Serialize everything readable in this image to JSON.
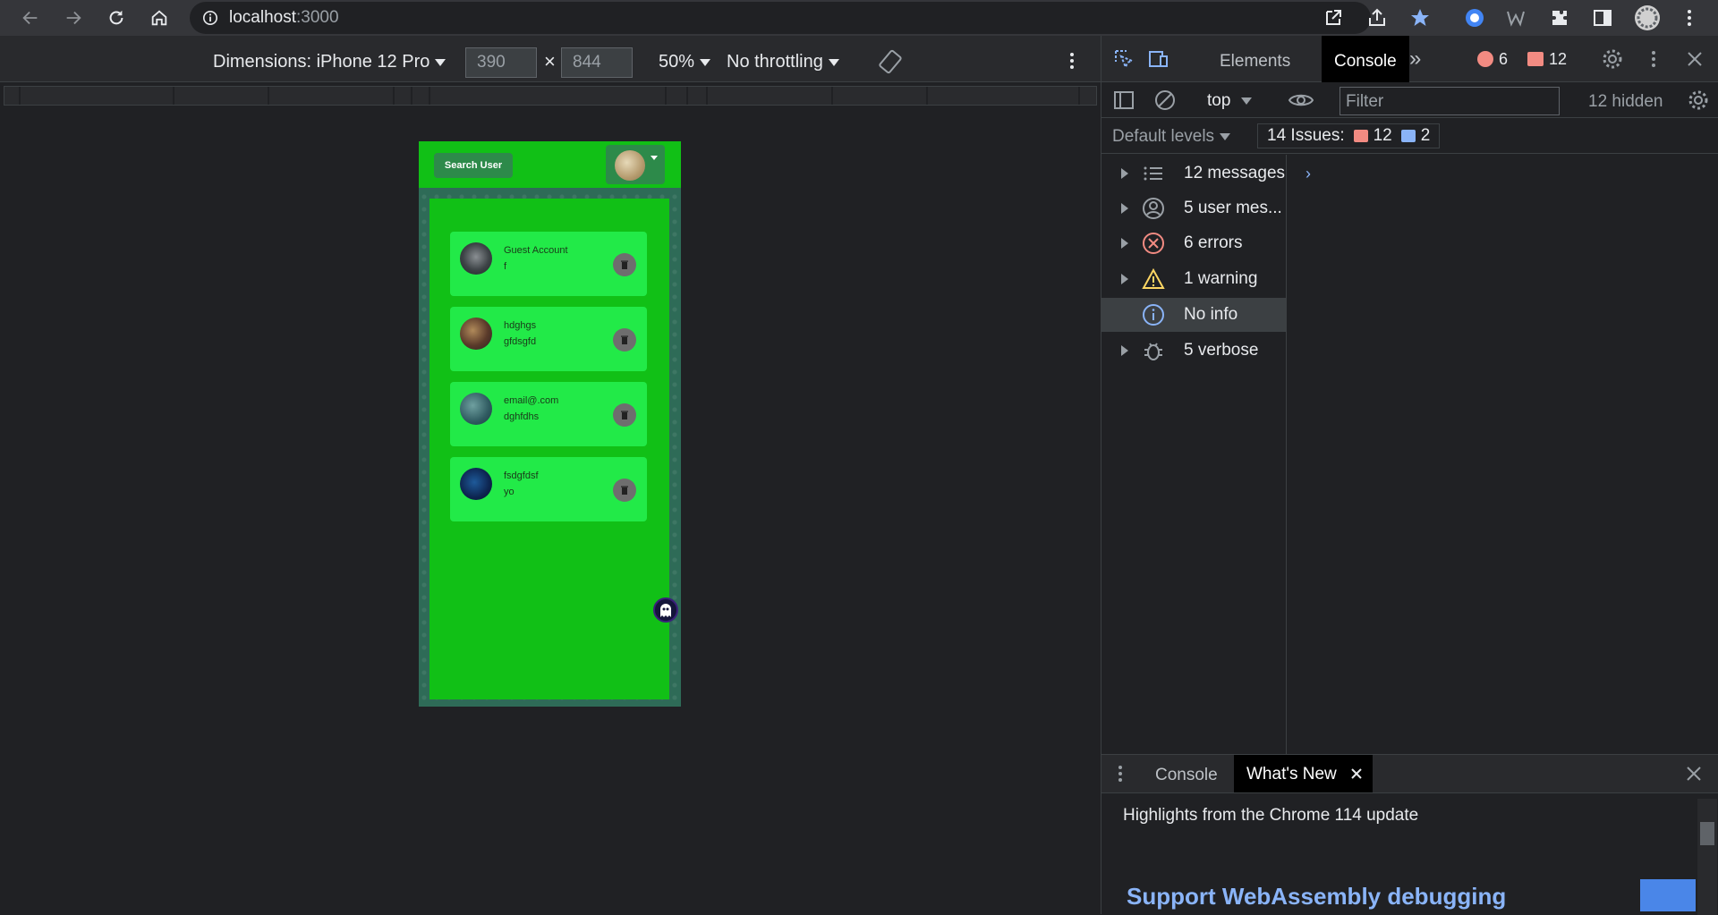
{
  "browser": {
    "url_host": "localhost",
    "url_port": ":3000"
  },
  "device_toolbar": {
    "dimensions_label": "Dimensions: iPhone 12 Pro",
    "width_value": "390",
    "height_value": "844",
    "times": "×",
    "zoom": "50%",
    "throttling": "No throttling"
  },
  "app": {
    "search_button": "Search User",
    "chats": [
      {
        "name": "Guest Account",
        "message": "f"
      },
      {
        "name": "hdghgs",
        "message": "gfdsgfd"
      },
      {
        "name": "email@.com",
        "message": "dghfdhs"
      },
      {
        "name": "fsdgfdsf",
        "message": "yo"
      }
    ]
  },
  "devtools": {
    "tabs": {
      "elements": "Elements",
      "console": "Console"
    },
    "error_count": "6",
    "issue_count": "12",
    "context": "top",
    "filter_placeholder": "Filter",
    "hidden": "12 hidden",
    "default_levels": "Default levels",
    "issues_label": "14 Issues:",
    "issues_errors": "12",
    "issues_info": "2",
    "sidebar": [
      {
        "label": "12 messages",
        "icon": "list-icon"
      },
      {
        "label": "5 user mes...",
        "icon": "user-icon"
      },
      {
        "label": "6 errors",
        "icon": "error-icon"
      },
      {
        "label": "1 warning",
        "icon": "warning-icon"
      },
      {
        "label": "No info",
        "icon": "info-icon"
      },
      {
        "label": "5 verbose",
        "icon": "bug-icon"
      }
    ],
    "drawer": {
      "tab_console": "Console",
      "tab_whats_new": "What's New",
      "highlights": "Highlights from the Chrome 114 update",
      "headline": "Support WebAssembly debugging"
    }
  }
}
